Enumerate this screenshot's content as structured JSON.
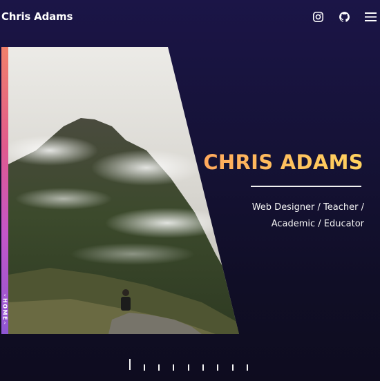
{
  "header": {
    "brand": "Chris Adams",
    "icons": [
      "instagram-icon",
      "github-icon",
      "menu-icon"
    ]
  },
  "sidebar": {
    "label": "HOME"
  },
  "hero": {
    "name": "CHRIS ADAMS",
    "roles": "Web Designer / Teacher / Academic / Educator"
  },
  "colors": {
    "accent_start": "#ffa95c",
    "accent_end": "#ffd35f",
    "background": "#151236"
  }
}
